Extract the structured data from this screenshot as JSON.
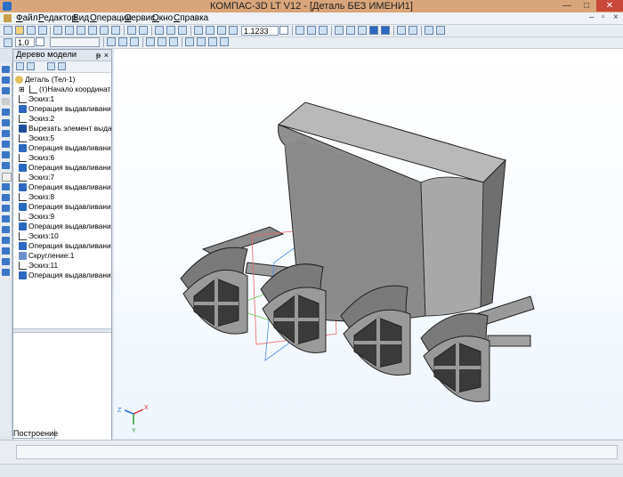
{
  "window": {
    "title": "КОМПАС-3D LT V12 - [Деталь БЕЗ ИМЕНИ1]"
  },
  "menu": {
    "items": [
      {
        "u": "Ф",
        "rest": "айл"
      },
      {
        "u": "Р",
        "rest": "едактор"
      },
      {
        "u": "В",
        "rest": "ид"
      },
      {
        "u": "О",
        "rest": "перации"
      },
      {
        "u": "С",
        "rest": "ервис"
      },
      {
        "u": "О",
        "rest": "кно"
      },
      {
        "u": "С",
        "rest": "правка"
      }
    ]
  },
  "toolbar": {
    "zoom_value": "1.1233",
    "step_value": "1.0"
  },
  "tree_panel": {
    "title": "Дерево модели",
    "pin_glyph": "ᵽ",
    "close_glyph": "×",
    "root": "Деталь (Тел-1)",
    "origin": "(т)Начало координат",
    "items": [
      {
        "label": "Эскиз:1",
        "kind": "sketch"
      },
      {
        "label": "Операция выдавливания",
        "kind": "extrude"
      },
      {
        "label": "Эскиз:2",
        "kind": "sketch"
      },
      {
        "label": "Вырезать элемент выдав.",
        "kind": "cut"
      },
      {
        "label": "Эскиз:5",
        "kind": "sketch"
      },
      {
        "label": "Операция выдавливания",
        "kind": "extrude"
      },
      {
        "label": "Эскиз:6",
        "kind": "sketch"
      },
      {
        "label": "Операция выдавливания",
        "kind": "extrude"
      },
      {
        "label": "Эскиз:7",
        "kind": "sketch"
      },
      {
        "label": "Операция выдавливания",
        "kind": "extrude"
      },
      {
        "label": "Эскиз:8",
        "kind": "sketch"
      },
      {
        "label": "Операция выдавливания",
        "kind": "extrude"
      },
      {
        "label": "Эскиз:9",
        "kind": "sketch"
      },
      {
        "label": "Операция выдавливания",
        "kind": "extrude"
      },
      {
        "label": "Эскиз:10",
        "kind": "sketch"
      },
      {
        "label": "Операция выдавливания",
        "kind": "extrude"
      },
      {
        "label": "Скругление:1",
        "kind": "fillet"
      },
      {
        "label": "Эскиз:11",
        "kind": "sketch"
      },
      {
        "label": "Операция выдавливания",
        "kind": "extrude"
      }
    ],
    "tab_label": "Построение"
  },
  "axes": {
    "x": "X",
    "y": "Y",
    "z": "Z"
  },
  "colors": {
    "title_bar": "#d9a57a",
    "accent": "#2d68c0",
    "viewport": "#ffffff",
    "model": "#8e8e8e"
  }
}
